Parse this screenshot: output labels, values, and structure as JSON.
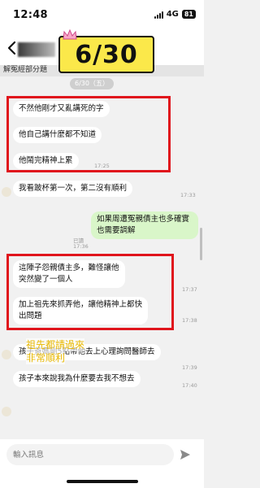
{
  "status": {
    "time": "12:48",
    "network": "4G",
    "battery": "81"
  },
  "header": {
    "date_sticker": "6/30"
  },
  "chat": {
    "prev_message": "解冤經部分題",
    "date_divider": "6/30（五）",
    "messages": [
      {
        "text": "不然他剛才又亂講死的字"
      },
      {
        "text": "他自己講什麼都不知道"
      },
      {
        "text": "他鬧完精神上累",
        "time": "17:25"
      },
      {
        "text": "我看跛杯第一次，第二沒有順利",
        "time": "17:33"
      },
      {
        "text": "如果周遭冤親債主也多確實也需要調解",
        "read": "已讀",
        "time": "17:36"
      },
      {
        "line1": "這陣子怨親債主多，難怪讓他",
        "line2": "突然變了一個人",
        "time": "17:37"
      },
      {
        "line1": "加上祖先來抓弄他，讓他精神上都快",
        "line2": "出問題",
        "time": "17:38"
      },
      {
        "text": "孩子爸媽剛5點帶他去上心理詢問醫師去",
        "time": "17:39"
      },
      {
        "text": "孩子本來說我為什麼要去我不想去",
        "time": "17:40"
      }
    ],
    "overlay_note": [
      "祖先都請過來",
      "非常順利"
    ]
  },
  "composer": {
    "placeholder": "輸入訊息"
  },
  "icons": {
    "back": "chevron-left-icon",
    "send": "send-icon",
    "crown": "crown-icon"
  },
  "colors": {
    "highlight": "#e0141c",
    "sticker": "#fbe84a",
    "my_bubble": "#d9f6c9",
    "overlay_text": "#e8b800"
  }
}
